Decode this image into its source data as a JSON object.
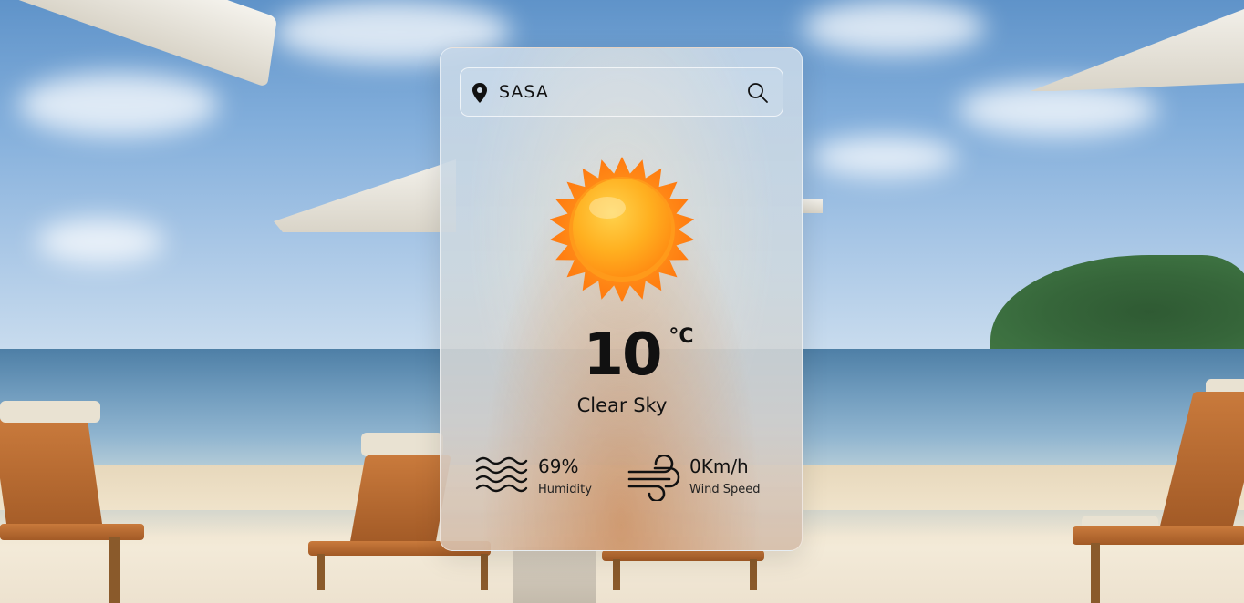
{
  "search": {
    "value": "SASA",
    "location_icon": "map-pin-icon",
    "search_icon": "search-icon"
  },
  "weather": {
    "icon": "sun-icon",
    "temperature": "10",
    "unit": "°C",
    "description": "Clear Sky"
  },
  "humidity": {
    "icon": "waves-icon",
    "value": "69%",
    "label": "Humidity"
  },
  "wind": {
    "icon": "wind-icon",
    "value": "0Km/h",
    "label": "Wind Speed"
  },
  "colors": {
    "text": "#111111",
    "sun_core": "#ffb627",
    "sun_rays": "#ff8a1c"
  }
}
